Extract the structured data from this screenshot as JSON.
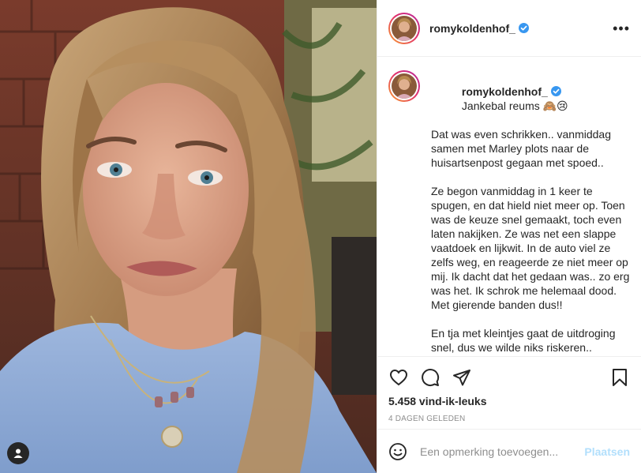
{
  "post": {
    "username": "romykoldenhof_",
    "verified": true,
    "more_icon": "more-horizontal-icon",
    "caption_title": "Jankebal reums 🙈😢",
    "caption_paragraphs": [
      "Dat was even schrikken.. vanmiddag samen met Marley plots naar de huisartsenpost gegaan met spoed..",
      "Ze begon vanmiddag in 1 keer te spugen, en dat hield niet meer op. Toen was de keuze snel gemaakt, toch even laten nakijken. Ze was net een slappe vaatdoek en lijkwit. In de auto viel ze zelfs weg, en reageerde ze niet meer op mij. Ik dacht dat het gedaan was.. zo erg was het. Ik schrok me helemaal dood. Met gierende banden dus!!",
      "En tja met kleintjes gaat de uitdroging snel, dus we wilde niks riskeren.."
    ],
    "likes": "5.458 vind-ik-leuks",
    "date": "4 dagen geleden"
  },
  "comment": {
    "placeholder": "Een opmerking toevoegen...",
    "submit_label": "Plaatsen"
  },
  "icons": {
    "like": "heart-icon",
    "comment": "comment-bubble-icon",
    "share": "paper-plane-icon",
    "save": "bookmark-icon",
    "emoji": "smiley-icon",
    "tag": "user-tag-icon"
  },
  "colors": {
    "verified_blue": "#3897f0",
    "post_button_disabled": "#b2dffc",
    "muted_text": "#8e8e8e",
    "border": "#efefef"
  }
}
